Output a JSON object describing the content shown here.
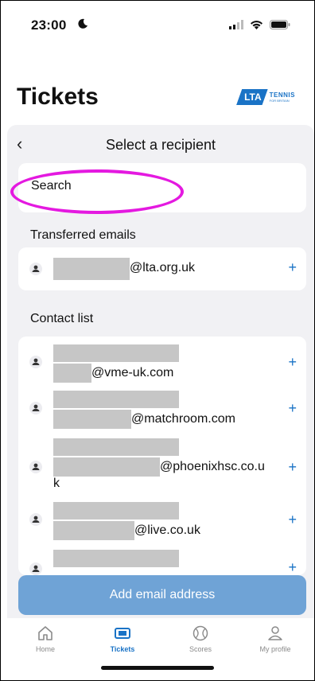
{
  "status_bar": {
    "time": "23:00"
  },
  "header": {
    "title": "Tickets",
    "logo_text": "LTA",
    "logo_sub_big": "TENNIS",
    "logo_sub_small": "FOR BRITAIN"
  },
  "sheet": {
    "title": "Select a recipient",
    "search": {
      "placeholder": "Search"
    },
    "transferred_section": "Transferred emails",
    "transferred": [
      {
        "email_suffix": "@lta.org.uk"
      }
    ],
    "contacts_section": "Contact list",
    "contacts": [
      {
        "email_suffix": "@vme-uk.com"
      },
      {
        "email_suffix": "@matchroom.com"
      },
      {
        "email_suffix": "@phoenixhsc.co.u",
        "email_wrap": "k"
      },
      {
        "email_suffix": "@live.co.uk"
      }
    ],
    "add_button": "Add email address",
    "plus_label": "+"
  },
  "tabbar": {
    "items": [
      {
        "label": "Home",
        "icon": "home-icon"
      },
      {
        "label": "Tickets",
        "icon": "ticket-icon",
        "active": true
      },
      {
        "label": "Scores",
        "icon": "tennis-ball-icon"
      },
      {
        "label": "My profile",
        "icon": "user-icon"
      }
    ]
  },
  "colors": {
    "accent": "#1a73c6",
    "button": "#6fa3d6",
    "highlight": "#e419e0",
    "sheet_bg": "#f1f1f4"
  }
}
